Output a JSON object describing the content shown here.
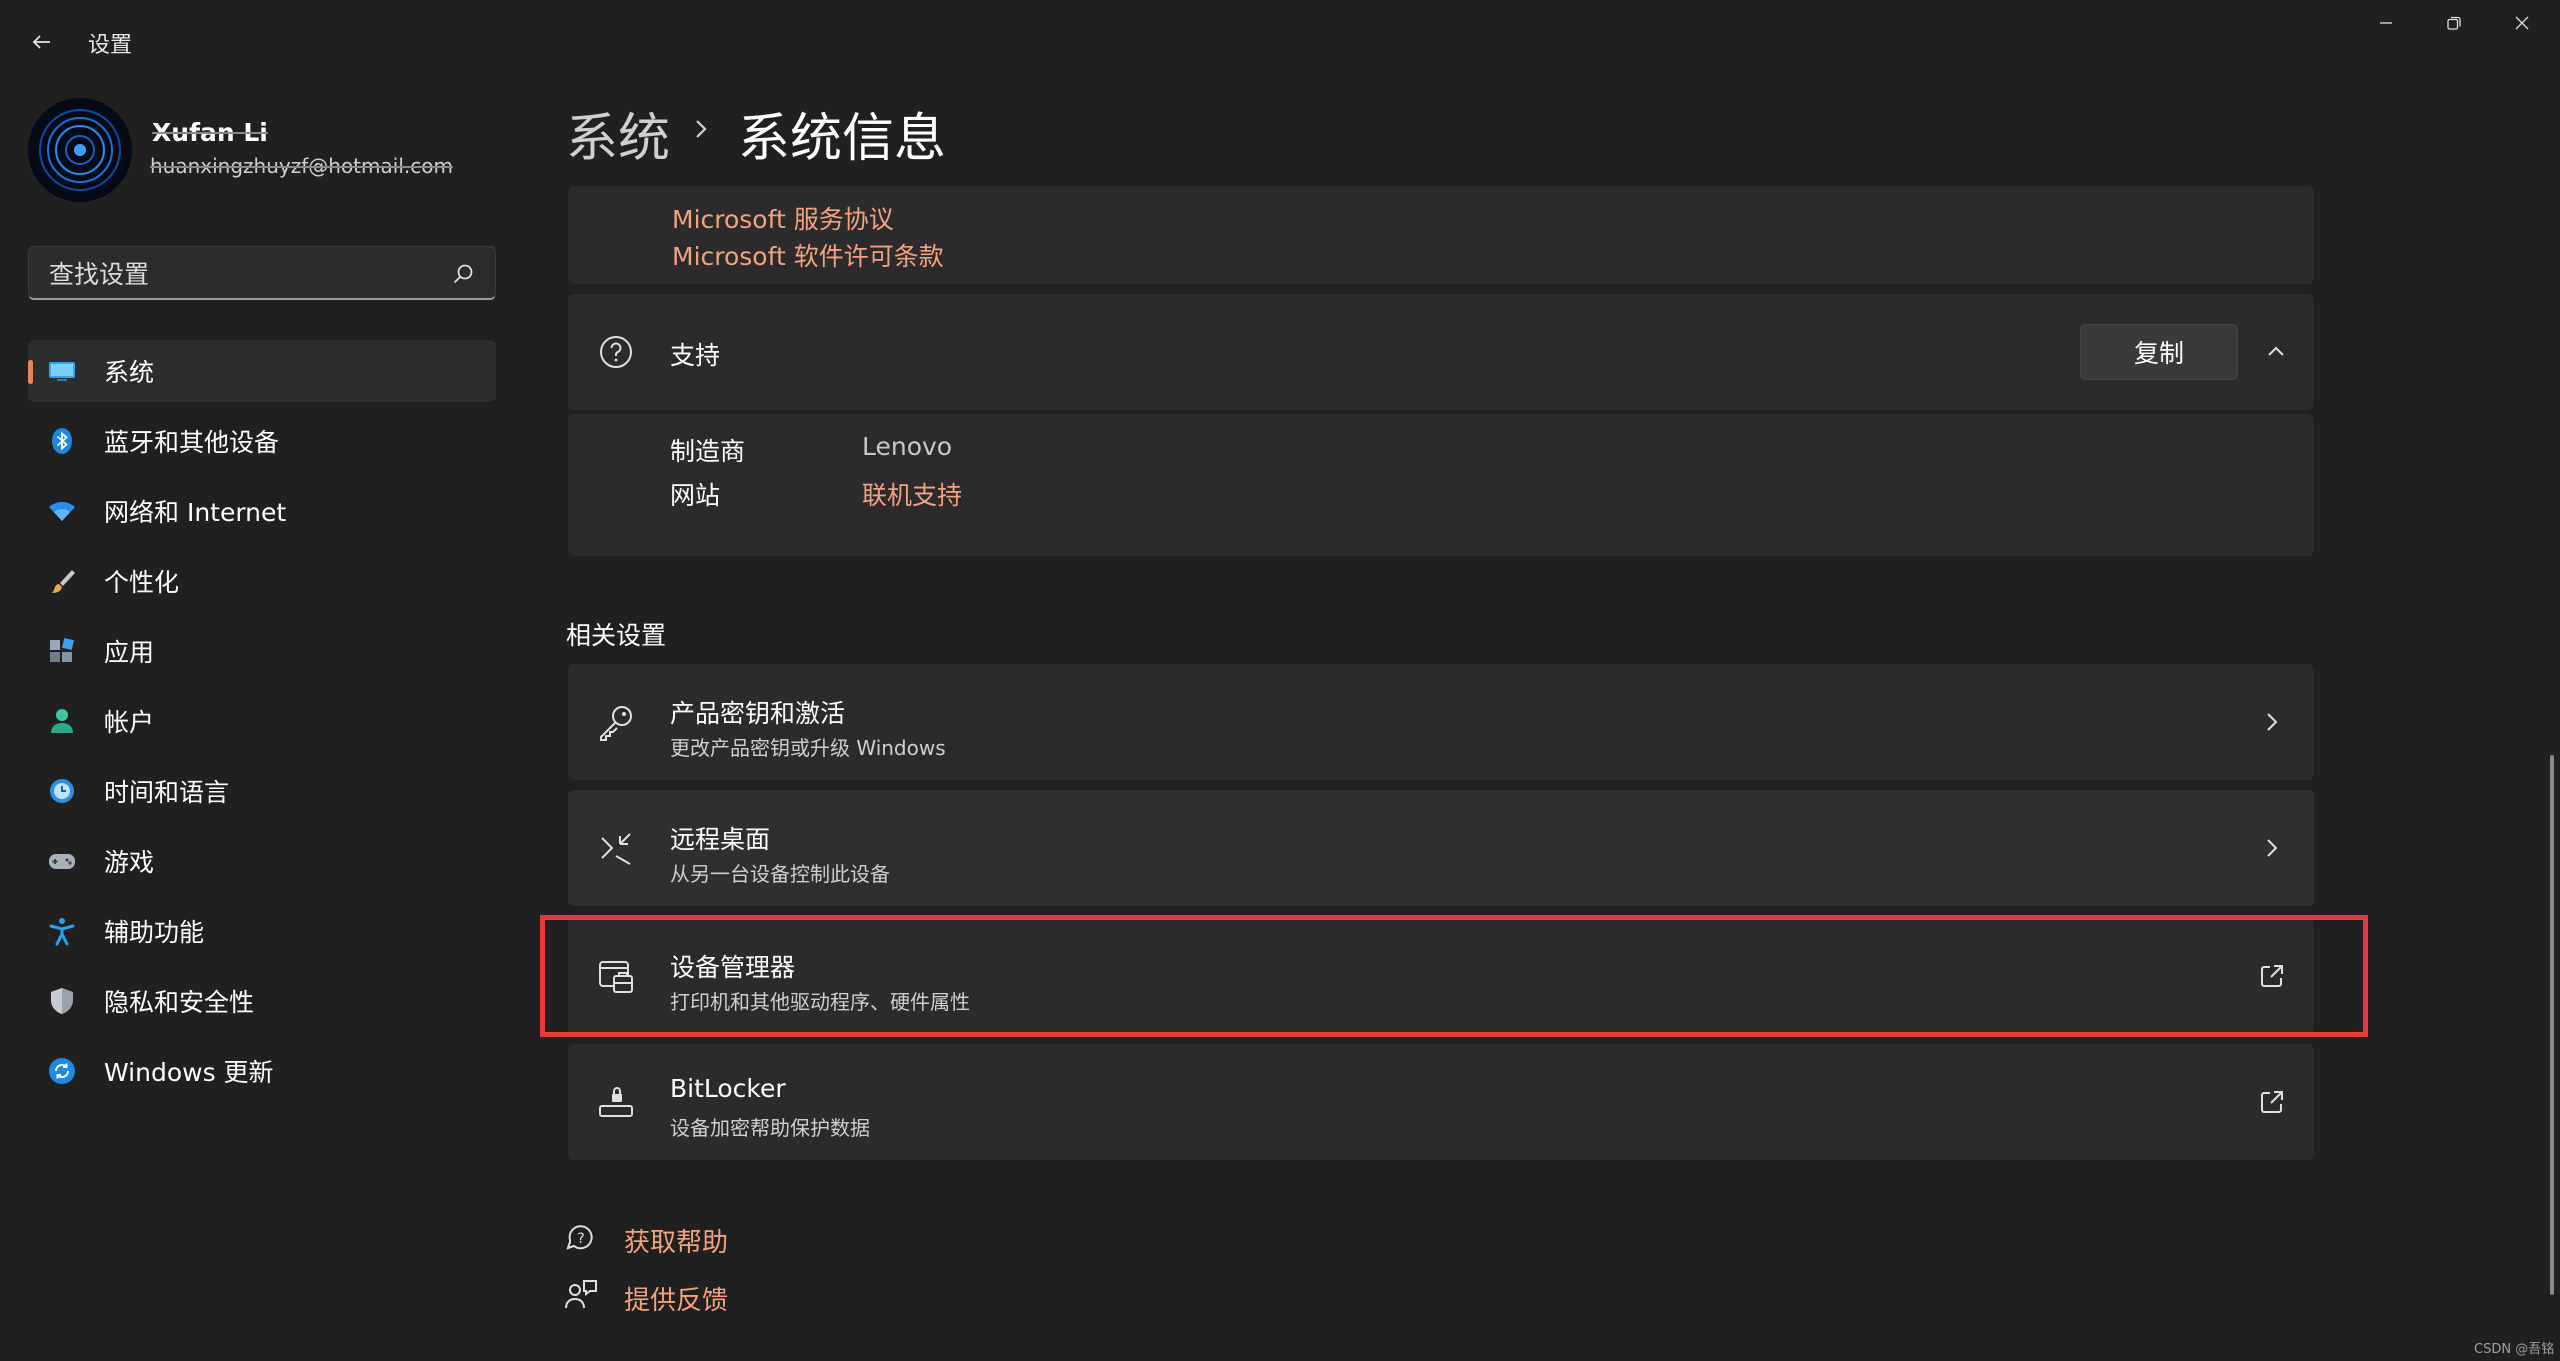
{
  "window": {
    "title": "设置"
  },
  "profile": {
    "name": "Xufan Li",
    "email": "huanxingzhuyzf@hotmail.com"
  },
  "search": {
    "placeholder": "查找设置"
  },
  "nav": {
    "items": [
      {
        "label": "系统",
        "icon": "system-icon",
        "active": true
      },
      {
        "label": "蓝牙和其他设备",
        "icon": "bluetooth-icon"
      },
      {
        "label": "网络和 Internet",
        "icon": "wifi-icon"
      },
      {
        "label": "个性化",
        "icon": "brush-icon"
      },
      {
        "label": "应用",
        "icon": "apps-icon"
      },
      {
        "label": "帐户",
        "icon": "account-icon"
      },
      {
        "label": "时间和语言",
        "icon": "time-language-icon"
      },
      {
        "label": "游戏",
        "icon": "gamepad-icon"
      },
      {
        "label": "辅助功能",
        "icon": "accessibility-icon"
      },
      {
        "label": "隐私和安全性",
        "icon": "shield-icon"
      },
      {
        "label": "Windows 更新",
        "icon": "update-icon"
      }
    ]
  },
  "breadcrumb": {
    "parent": "系统",
    "current": "系统信息"
  },
  "legal": {
    "links": [
      "Microsoft 服务协议",
      "Microsoft 软件许可条款"
    ]
  },
  "support": {
    "title": "支持",
    "copy_label": "复制",
    "rows": [
      {
        "label": "制造商",
        "value": "Lenovo"
      },
      {
        "label": "网站",
        "value": "联机支持"
      }
    ]
  },
  "related": {
    "title": "相关设置",
    "items": [
      {
        "title": "产品密钥和激活",
        "subtitle": "更改产品密钥或升级 Windows",
        "icon": "key-icon",
        "action": "chevron-right-icon"
      },
      {
        "title": "远程桌面",
        "subtitle": "从另一台设备控制此设备",
        "icon": "remote-desktop-icon",
        "action": "chevron-right-icon"
      },
      {
        "title": "设备管理器",
        "subtitle": "打印机和其他驱动程序、硬件属性",
        "icon": "device-manager-icon",
        "action": "external-link-icon",
        "highlighted": true
      },
      {
        "title": "BitLocker",
        "subtitle": "设备加密帮助保护数据",
        "icon": "bitlocker-icon",
        "action": "external-link-icon"
      }
    ]
  },
  "help": {
    "get_help": "获取帮助",
    "feedback": "提供反馈"
  },
  "watermark": "CSDN @吾铭",
  "colors": {
    "background": "#202020",
    "card": "#2b2b2b",
    "accent": "#e8855f",
    "link": "#f3a280",
    "highlight_box": "#e33a3a"
  }
}
